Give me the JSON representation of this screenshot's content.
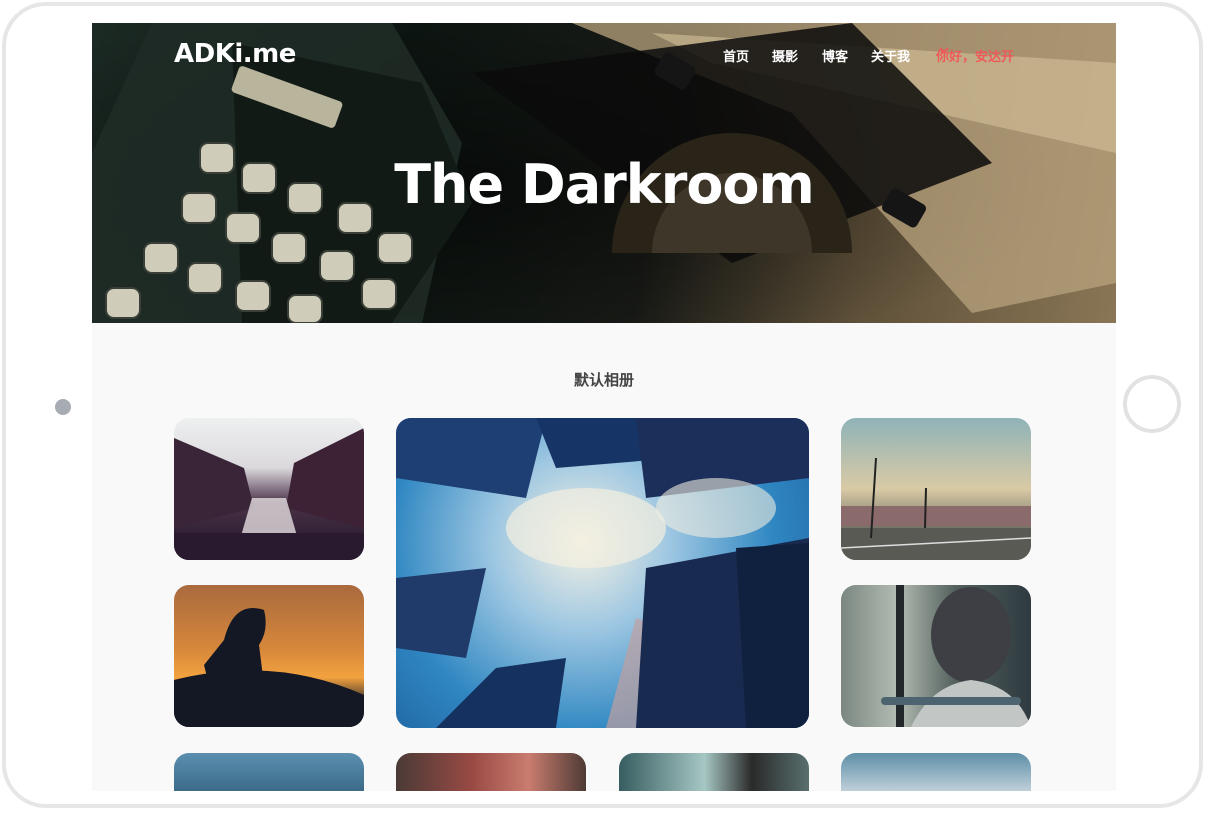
{
  "site": {
    "brand": "ADKi.me"
  },
  "nav": {
    "items": [
      "首页",
      "摄影",
      "博客",
      "关于我"
    ],
    "user_greeting": "你好，安达开"
  },
  "hero": {
    "title": "The Darkroom"
  },
  "album": {
    "title": "默认相册"
  },
  "photos": [
    "canal-city-night",
    "skyscrapers-sky",
    "railway-yard",
    "silhouette-sunset",
    "woman-on-bus",
    "city-skyline",
    "red-door-alley",
    "man-portrait",
    "mountain-birds"
  ],
  "colors": {
    "accent": "#ee5a5a",
    "background": "#f9f9f9"
  }
}
